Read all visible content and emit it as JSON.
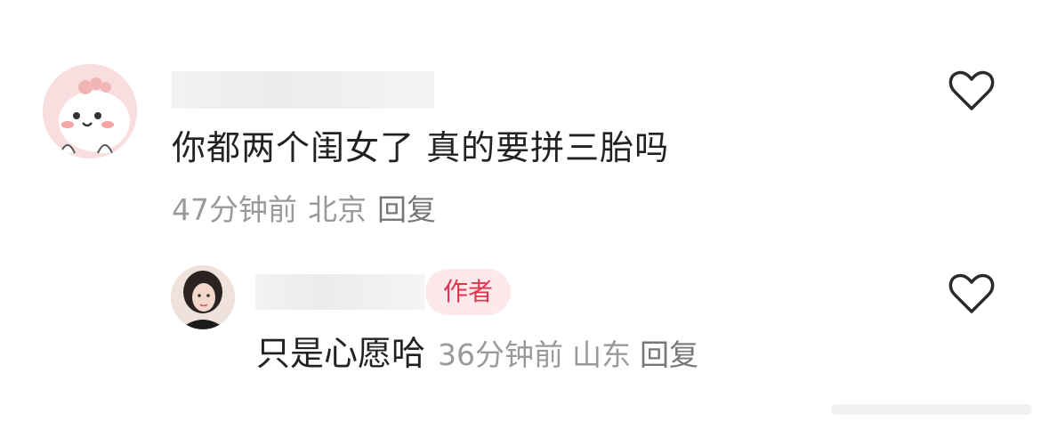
{
  "comments": [
    {
      "text": "你都两个闺女了 真的要拼三胎吗",
      "time": "47分钟前",
      "location": "北京",
      "reply_label": "回复",
      "like_icon": "heart-outline-icon",
      "avatar": "cartoon-avatar"
    }
  ],
  "reply": {
    "badge": "作者",
    "text": "只是心愿哈",
    "time": "36分钟前",
    "location": "山东",
    "reply_label": "回复",
    "like_icon": "heart-outline-icon",
    "avatar": "user-photo-avatar"
  },
  "colors": {
    "badge_bg": "#fde9ec",
    "badge_text": "#e0344f",
    "meta_text": "#9a9a9a",
    "body_text": "#222222"
  }
}
